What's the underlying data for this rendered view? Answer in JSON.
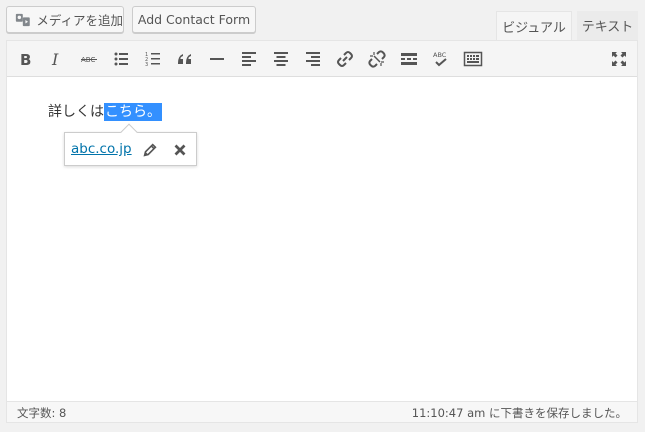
{
  "top": {
    "media_button_label": "メディアを追加",
    "contact_form_button_label": "Add Contact Form",
    "tab_visual": "ビジュアル",
    "tab_text": "テキスト"
  },
  "toolbar": {
    "buttons": [
      "bold",
      "italic",
      "strikethrough",
      "bulleted-list",
      "numbered-list",
      "blockquote",
      "horizontal-line",
      "align-left",
      "align-center",
      "align-right",
      "insert-link",
      "remove-link",
      "read-more",
      "spellcheck",
      "toolbar-toggle",
      "fullscreen"
    ]
  },
  "content": {
    "text_before": "詳しくは",
    "selected_text": "こちら。"
  },
  "link_popup": {
    "url": "abc.co.jp"
  },
  "status": {
    "word_count": "文字数: 8",
    "autosave": "11:10:47 am に下書きを保存しました。"
  },
  "colors": {
    "selection": "#3390ff",
    "link": "#0073aa"
  }
}
